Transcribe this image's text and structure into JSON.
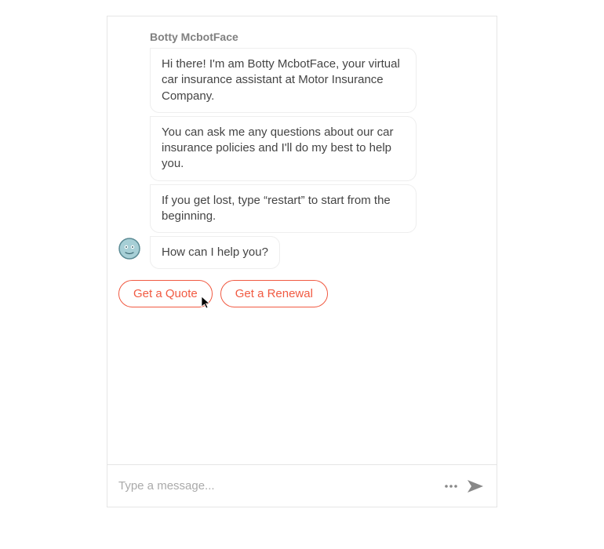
{
  "bot": {
    "name": "Botty McbotFace"
  },
  "messages": [
    {
      "text": "Hi there! I'm am Botty McbotFace, your virtual car insurance assistant at Motor Insurance Company."
    },
    {
      "text": "You can ask me any questions about our car insurance policies and I'll do my best to help you."
    },
    {
      "text": "If you get lost, type “restart” to start from the beginning."
    },
    {
      "text": "How can I help you?"
    }
  ],
  "quick_replies": [
    {
      "label": "Get a Quote"
    },
    {
      "label": "Get a Renewal"
    }
  ],
  "input": {
    "placeholder": "Type a message..."
  }
}
